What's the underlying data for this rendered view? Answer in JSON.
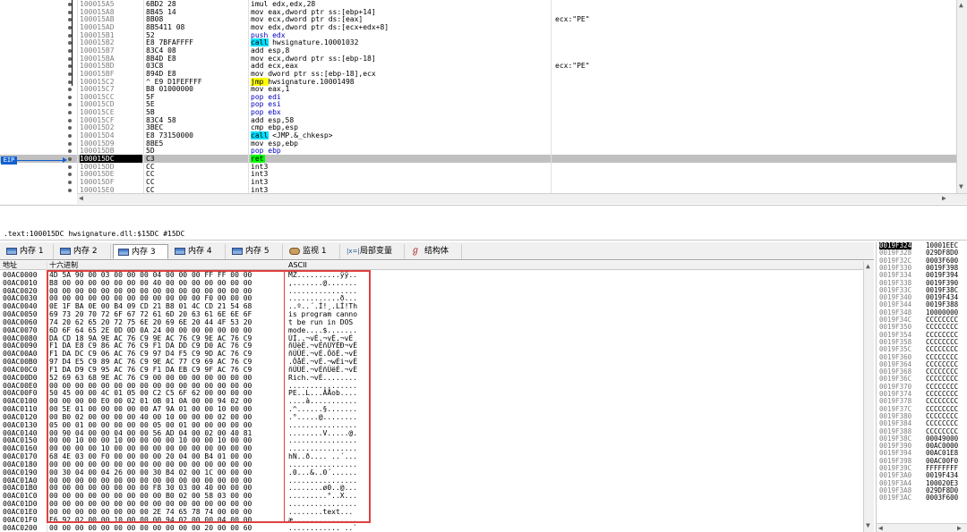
{
  "disassembly": {
    "eip_label": "EIP",
    "rows": [
      {
        "addr": "100015A5",
        "bytes": "6BD2 28",
        "instr": "imul edx,edx,28",
        "comment": ""
      },
      {
        "addr": "100015A8",
        "bytes": "8B45 14",
        "instr": "mov eax,dword ptr ss:[ebp+14]",
        "comment": ""
      },
      {
        "addr": "100015AB",
        "bytes": "8B08",
        "instr": "mov ecx,dword ptr ds:[eax]",
        "comment": "ecx:\"PE\""
      },
      {
        "addr": "100015AD",
        "bytes": "8B5411 08",
        "instr": "mov edx,dword ptr ds:[ecx+edx+8]",
        "comment": ""
      },
      {
        "addr": "100015B1",
        "bytes": "52",
        "instr": "push edx",
        "comment": ""
      },
      {
        "addr": "100015B2",
        "bytes": "E8 7BFAFFFF",
        "instr": "call hwsignature.10001032",
        "comment": ""
      },
      {
        "addr": "100015B7",
        "bytes": "83C4 08",
        "instr": "add esp,8",
        "comment": ""
      },
      {
        "addr": "100015BA",
        "bytes": "8B4D E8",
        "instr": "mov ecx,dword ptr ss:[ebp-18]",
        "comment": ""
      },
      {
        "addr": "100015BD",
        "bytes": "03C8",
        "instr": "add ecx,eax",
        "comment": "ecx:\"PE\""
      },
      {
        "addr": "100015BF",
        "bytes": "894D E8",
        "instr": "mov dword ptr ss:[ebp-18],ecx",
        "comment": ""
      },
      {
        "addr": "100015C2",
        "bytes": "^ E9 D1FEFFFF",
        "instr": "jmp hwsignature.10001498",
        "comment": ""
      },
      {
        "addr": "100015C7",
        "bytes": "B8 01000000",
        "instr": "mov eax,1",
        "comment": ""
      },
      {
        "addr": "100015CC",
        "bytes": "5F",
        "instr": "pop edi",
        "comment": ""
      },
      {
        "addr": "100015CD",
        "bytes": "5E",
        "instr": "pop esi",
        "comment": ""
      },
      {
        "addr": "100015CE",
        "bytes": "5B",
        "instr": "pop ebx",
        "comment": ""
      },
      {
        "addr": "100015CF",
        "bytes": "83C4 58",
        "instr": "add esp,58",
        "comment": ""
      },
      {
        "addr": "100015D2",
        "bytes": "3BEC",
        "instr": "cmp ebp,esp",
        "comment": ""
      },
      {
        "addr": "100015D4",
        "bytes": "E8 73150000",
        "instr": "call <JMP.&_chkesp>",
        "comment": ""
      },
      {
        "addr": "100015D9",
        "bytes": "8BE5",
        "instr": "mov esp,ebp",
        "comment": ""
      },
      {
        "addr": "100015DB",
        "bytes": "5D",
        "instr": "pop ebp",
        "comment": ""
      },
      {
        "addr": "100015DC",
        "bytes": "C3",
        "instr": "ret",
        "comment": ""
      },
      {
        "addr": "100015DD",
        "bytes": "CC",
        "instr": "int3",
        "comment": ""
      },
      {
        "addr": "100015DE",
        "bytes": "CC",
        "instr": "int3",
        "comment": ""
      },
      {
        "addr": "100015DF",
        "bytes": "CC",
        "instr": "int3",
        "comment": ""
      },
      {
        "addr": "100015E0",
        "bytes": "CC",
        "instr": "int3",
        "comment": ""
      }
    ]
  },
  "info_line": ".text:100015DC hwsignature.dll:$15DC #15DC",
  "tabs": [
    {
      "label": "内存 1",
      "icon": "memory-icon"
    },
    {
      "label": "内存 2",
      "icon": "memory-icon"
    },
    {
      "label": "内存 3",
      "icon": "memory-icon"
    },
    {
      "label": "内存 4",
      "icon": "memory-icon"
    },
    {
      "label": "内存 5",
      "icon": "memory-icon"
    },
    {
      "label": "监视 1",
      "icon": "watch-icon"
    },
    {
      "label": "局部变量",
      "icon": "local-vars-icon"
    },
    {
      "label": "结构体",
      "icon": "struct-icon"
    }
  ],
  "dump": {
    "headers": {
      "address": "地址",
      "hex": "十六进制",
      "ascii": "ASCII"
    },
    "rows": [
      {
        "addr": "00AC0000",
        "hex": "4D 5A 90 00 03 00 00 00 04 00 00 00 FF FF 00 00",
        "ascii": "MZ..........ÿÿ.."
      },
      {
        "addr": "00AC0010",
        "hex": "B8 00 00 00 00 00 00 00 40 00 00 00 00 00 00 00",
        "ascii": ",.......@......."
      },
      {
        "addr": "00AC0020",
        "hex": "00 00 00 00 00 00 00 00 00 00 00 00 00 00 00 00",
        "ascii": "................"
      },
      {
        "addr": "00AC0030",
        "hex": "00 00 00 00 00 00 00 00 00 00 00 00 F0 00 00 00",
        "ascii": "............ð..."
      },
      {
        "addr": "00AC0040",
        "hex": "0E 1F BA 0E 00 B4 09 CD 21 B8 01 4C CD 21 54 68",
        "ascii": "..º..´.Í!¸.LÍ!Th"
      },
      {
        "addr": "00AC0050",
        "hex": "69 73 20 70 72 6F 67 72 61 6D 20 63 61 6E 6E 6F",
        "ascii": "is program canno"
      },
      {
        "addr": "00AC0060",
        "hex": "74 20 62 65 20 72 75 6E 20 69 6E 20 44 4F 53 20",
        "ascii": "t be run in DOS "
      },
      {
        "addr": "00AC0070",
        "hex": "6D 6F 64 65 2E 0D 0D 0A 24 00 00 00 00 00 00 00",
        "ascii": "mode....$......."
      },
      {
        "addr": "00AC0080",
        "hex": "DA CD 18 9A 9E AC 76 C9 9E AC 76 C9 9E AC 76 C9",
        "ascii": "ÚÍ..¬vÉ.¬vÉ.¬vÉ"
      },
      {
        "addr": "00AC0090",
        "hex": "F1 DA E8 C9 86 AC 76 C9 F1 DA DD C9 D0 AC 76 C9",
        "ascii": "ñÚèÉ.¬vÉñÚÝÉÐ¬vÉ"
      },
      {
        "addr": "00AC00A0",
        "hex": "F1 DA DC C9 06 AC 76 C9 97 D4 F5 C9 9D AC 76 C9",
        "ascii": "ñÚÜÉ.¬vÉ.ÔõÉ.¬vÉ"
      },
      {
        "addr": "00AC00B0",
        "hex": "97 D4 E5 C9 89 AC 76 C9 9E AC 77 C9 69 AC 76 C9",
        "ascii": ".ÔåÉ.¬vÉ.¬wÉi¬vÉ"
      },
      {
        "addr": "00AC00C0",
        "hex": "F1 DA D9 C9 95 AC 76 C9 F1 DA EB C9 9F AC 76 C9",
        "ascii": "ñÚÙÉ.¬vÉñÚëÉ.¬vÉ"
      },
      {
        "addr": "00AC00D0",
        "hex": "52 69 63 68 9E AC 76 C9 00 00 00 00 00 00 00 00",
        "ascii": "Rich.¬vÉ........"
      },
      {
        "addr": "00AC00E0",
        "hex": "00 00 00 00 00 00 00 00 00 00 00 00 00 00 00 00",
        "ascii": "................"
      },
      {
        "addr": "00AC00F0",
        "hex": "50 45 00 00 4C 01 05 00 C2 C5 6F 62 00 00 00 00",
        "ascii": "PE..L...ÂÅob...."
      },
      {
        "addr": "00AC0100",
        "hex": "00 00 00 00 E0 00 02 01 0B 01 0A 00 00 94 02 00",
        "ascii": "....à..........."
      },
      {
        "addr": "00AC0110",
        "hex": "00 5E 01 00 00 00 00 00 A7 9A 01 00 00 10 00 00",
        "ascii": ".^......§......."
      },
      {
        "addr": "00AC0120",
        "hex": "00 B0 02 00 00 00 00 40 00 10 00 00 00 02 00 00",
        "ascii": ".°.....@........"
      },
      {
        "addr": "00AC0130",
        "hex": "05 00 01 00 00 00 00 00 05 00 01 00 00 00 00 00",
        "ascii": "................"
      },
      {
        "addr": "00AC0140",
        "hex": "00 90 04 00 00 04 00 00 56 AD 04 00 02 00 40 81",
        "ascii": "........V.....@."
      },
      {
        "addr": "00AC0150",
        "hex": "00 00 10 00 00 10 00 00 00 00 10 00 00 10 00 00",
        "ascii": "................"
      },
      {
        "addr": "00AC0160",
        "hex": "00 00 00 00 10 00 00 00 00 00 00 00 00 00 00 00",
        "ascii": "................"
      },
      {
        "addr": "00AC0170",
        "hex": "68 4E 03 00 F0 00 00 00 00 20 04 00 B4 01 00 00",
        "ascii": "hN..ð.... ..´..."
      },
      {
        "addr": "00AC0180",
        "hex": "00 00 00 00 00 00 00 00 00 00 00 00 00 00 00 00",
        "ascii": "................"
      },
      {
        "addr": "00AC0190",
        "hex": "00 30 04 00 04 26 00 00 30 B4 02 00 1C 00 00 00",
        "ascii": ".0...&..0´......"
      },
      {
        "addr": "00AC01A0",
        "hex": "00 00 00 00 00 00 00 00 00 00 00 00 00 00 00 00",
        "ascii": "................"
      },
      {
        "addr": "00AC01B0",
        "hex": "00 00 00 00 00 00 00 00 F8 30 03 00 40 00 00 00",
        "ascii": "........ø0..@..."
      },
      {
        "addr": "00AC01C0",
        "hex": "00 00 00 00 00 00 00 00 00 B0 02 00 58 03 00 00",
        "ascii": ".........°..X..."
      },
      {
        "addr": "00AC01D0",
        "hex": "00 00 00 00 00 00 00 00 00 00 00 00 00 00 00 00",
        "ascii": "................"
      },
      {
        "addr": "00AC01E0",
        "hex": "00 00 00 00 00 00 00 00 2E 74 65 78 74 00 00 00",
        "ascii": "........text..."
      },
      {
        "addr": "00AC01F0",
        "hex": "E6 92 02 00 00 10 00 00 00 94 02 00 00 04 00 00",
        "ascii": "æ..............."
      },
      {
        "addr": "00AC0200",
        "hex": "00 00 00 00 00 00 00 00 00 00 00 00 20 00 00 60",
        "ascii": "............ ..`"
      }
    ]
  },
  "stack": {
    "rows": [
      {
        "addr": "0019F324",
        "val": "10001EEC"
      },
      {
        "addr": "0019F328",
        "val": "029DF8D0"
      },
      {
        "addr": "0019F32C",
        "val": "0003F600"
      },
      {
        "addr": "0019F330",
        "val": "0019F398"
      },
      {
        "addr": "0019F334",
        "val": "0019F394"
      },
      {
        "addr": "0019F338",
        "val": "0019F390"
      },
      {
        "addr": "0019F33C",
        "val": "0019F38C"
      },
      {
        "addr": "0019F340",
        "val": "0019F434"
      },
      {
        "addr": "0019F344",
        "val": "0019F388"
      },
      {
        "addr": "0019F348",
        "val": "10000000"
      },
      {
        "addr": "0019F34C",
        "val": "CCCCCCCC"
      },
      {
        "addr": "0019F350",
        "val": "CCCCCCCC"
      },
      {
        "addr": "0019F354",
        "val": "CCCCCCCC"
      },
      {
        "addr": "0019F358",
        "val": "CCCCCCCC"
      },
      {
        "addr": "0019F35C",
        "val": "CCCCCCCC"
      },
      {
        "addr": "0019F360",
        "val": "CCCCCCCC"
      },
      {
        "addr": "0019F364",
        "val": "CCCCCCCC"
      },
      {
        "addr": "0019F368",
        "val": "CCCCCCCC"
      },
      {
        "addr": "0019F36C",
        "val": "CCCCCCCC"
      },
      {
        "addr": "0019F370",
        "val": "CCCCCCCC"
      },
      {
        "addr": "0019F374",
        "val": "CCCCCCCC"
      },
      {
        "addr": "0019F378",
        "val": "CCCCCCCC"
      },
      {
        "addr": "0019F37C",
        "val": "CCCCCCCC"
      },
      {
        "addr": "0019F380",
        "val": "CCCCCCCC"
      },
      {
        "addr": "0019F384",
        "val": "CCCCCCCC"
      },
      {
        "addr": "0019F388",
        "val": "CCCCCCCC"
      },
      {
        "addr": "0019F38C",
        "val": "00049000"
      },
      {
        "addr": "0019F390",
        "val": "00AC0000"
      },
      {
        "addr": "0019F394",
        "val": "00AC01E8"
      },
      {
        "addr": "0019F398",
        "val": "00AC00F0"
      },
      {
        "addr": "0019F39C",
        "val": "FFFFFFFF"
      },
      {
        "addr": "0019F3A0",
        "val": "0019F434"
      },
      {
        "addr": "0019F3A4",
        "val": "100020E3"
      },
      {
        "addr": "0019F3A8",
        "val": "029DF8D0"
      },
      {
        "addr": "0019F3AC",
        "val": "0003F600"
      }
    ]
  },
  "colors": {
    "eip_marker": "#1060d0",
    "dump_frame": "#e04040",
    "call_highlight": "#00e0ff",
    "jmp_highlight": "#ffff00"
  }
}
